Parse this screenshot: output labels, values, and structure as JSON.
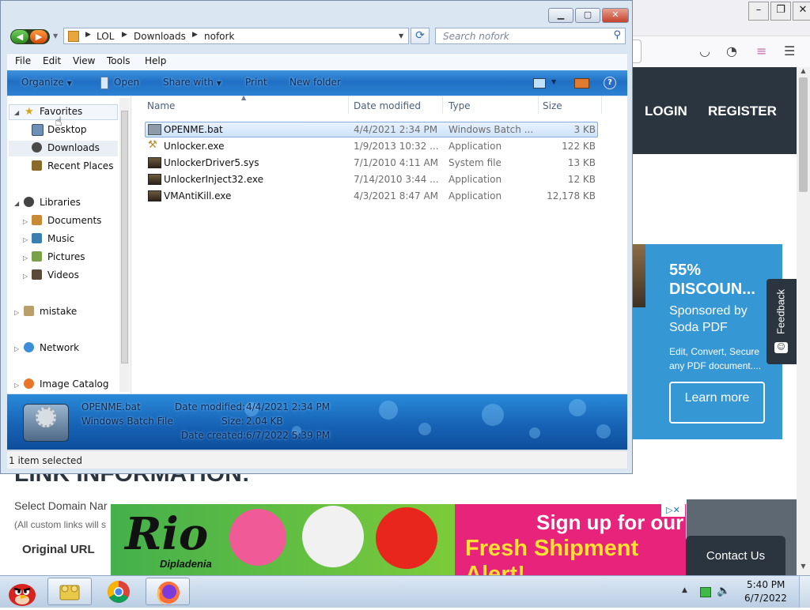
{
  "background_page": {
    "header_links": [
      "LOGIN",
      "REGISTER"
    ],
    "ad_card": {
      "title": "55% DISCOUN...",
      "sponsor": "Sponsored by Soda PDF",
      "description": "Edit, Convert, Secure any PDF document....",
      "button": "Learn more"
    },
    "feedback_label": "Feedback",
    "section_heading": "LINK INFORMATION:",
    "domain_label": "Select Domain Nar",
    "custom_note": "(All custom links will s",
    "original_url_label": "Original URL",
    "banner_ad": {
      "logo": "Rio",
      "logo_sub": "Dipladenia",
      "headline1": "Sign up for our",
      "headline2": "Fresh Shipment Alert!"
    },
    "contact_button": "Contact Us",
    "colors": {
      "header": "#2b3540",
      "ad": "#3597d3",
      "banner_pink": "#e8237b",
      "banner_green": "#44b04b"
    }
  },
  "explorer": {
    "address": {
      "crumbs": [
        "LOL",
        "Downloads",
        "nofork"
      ]
    },
    "search_placeholder": "Search nofork",
    "menu": [
      "File",
      "Edit",
      "View",
      "Tools",
      "Help"
    ],
    "commands": {
      "organize": "Organize",
      "open": "Open",
      "share_with": "Share with",
      "print": "Print",
      "new_folder": "New folder"
    },
    "nav": {
      "favorites": "Favorites",
      "favorites_items": [
        "Desktop",
        "Downloads",
        "Recent Places"
      ],
      "libraries": "Libraries",
      "libraries_items": [
        "Documents",
        "Music",
        "Pictures",
        "Videos"
      ],
      "mistake": "mistake",
      "network": "Network",
      "image_catalog": "Image Catalog"
    },
    "columns": [
      "Name",
      "Date modified",
      "Type",
      "Size"
    ],
    "files": [
      {
        "name": "OPENME.bat",
        "date": "4/4/2021 2:34 PM",
        "type": "Windows Batch ...",
        "size": "3 KB"
      },
      {
        "name": "Unlocker.exe",
        "date": "1/9/2013 10:32 ...",
        "type": "Application",
        "size": "122 KB"
      },
      {
        "name": "UnlockerDriver5.sys",
        "date": "7/1/2010 4:11 AM",
        "type": "System file",
        "size": "13 KB"
      },
      {
        "name": "UnlockerInject32.exe",
        "date": "7/14/2010 3:44 ...",
        "type": "Application",
        "size": "12 KB"
      },
      {
        "name": "VMAntiKill.exe",
        "date": "4/3/2021 8:47 AM",
        "type": "Application",
        "size": "12,178 KB"
      }
    ],
    "selected_file_index": 0,
    "details": {
      "name": "OPENME.bat",
      "type": "Windows Batch File",
      "date_modified_label": "Date modified:",
      "date_modified": "4/4/2021 2:34 PM",
      "size_label": "Size:",
      "size": "2.04 KB",
      "date_created_label": "Date created:",
      "date_created": "6/7/2022 5:39 PM"
    },
    "status": "1 item selected"
  },
  "taskbar": {
    "time": "5:40 PM",
    "date": "6/7/2022",
    "icons": [
      "angry-birds-start-icon",
      "windows-explorer-icon",
      "chrome-icon",
      "firefox-icon"
    ]
  }
}
